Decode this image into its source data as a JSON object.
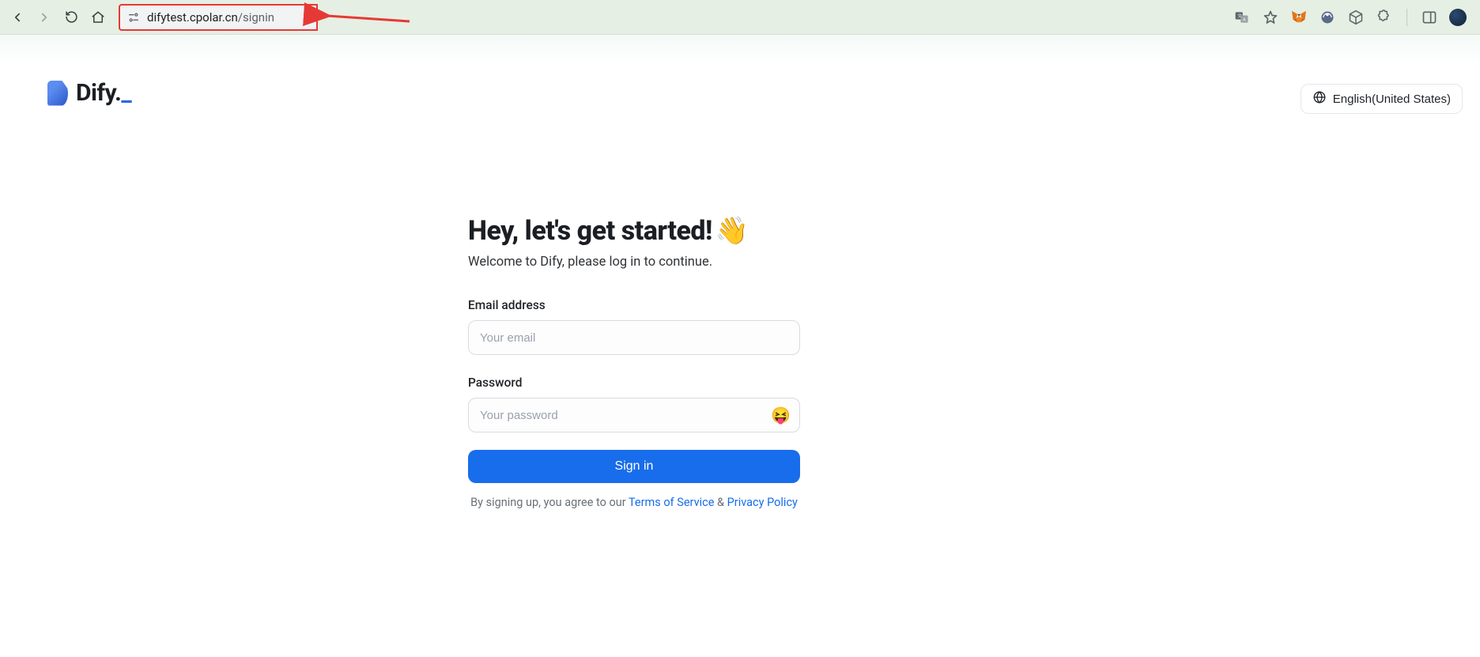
{
  "browser": {
    "url_domain": "difytest.cpolar.cn",
    "url_path": "/signin"
  },
  "header": {
    "brand": "Dify",
    "language_label": "English(United States)"
  },
  "signin": {
    "headline": "Hey, let's get started!",
    "wave_emoji": "👋",
    "subhead": "Welcome to Dify, please log in to continue.",
    "email_label": "Email address",
    "email_placeholder": "Your email",
    "password_label": "Password",
    "password_placeholder": "Your password",
    "toggle_emoji": "😝",
    "submit_label": "Sign in",
    "legal_prefix": "By signing up, you agree to our ",
    "tos_label": "Terms of Service",
    "legal_sep": " & ",
    "privacy_label": "Privacy Policy"
  }
}
